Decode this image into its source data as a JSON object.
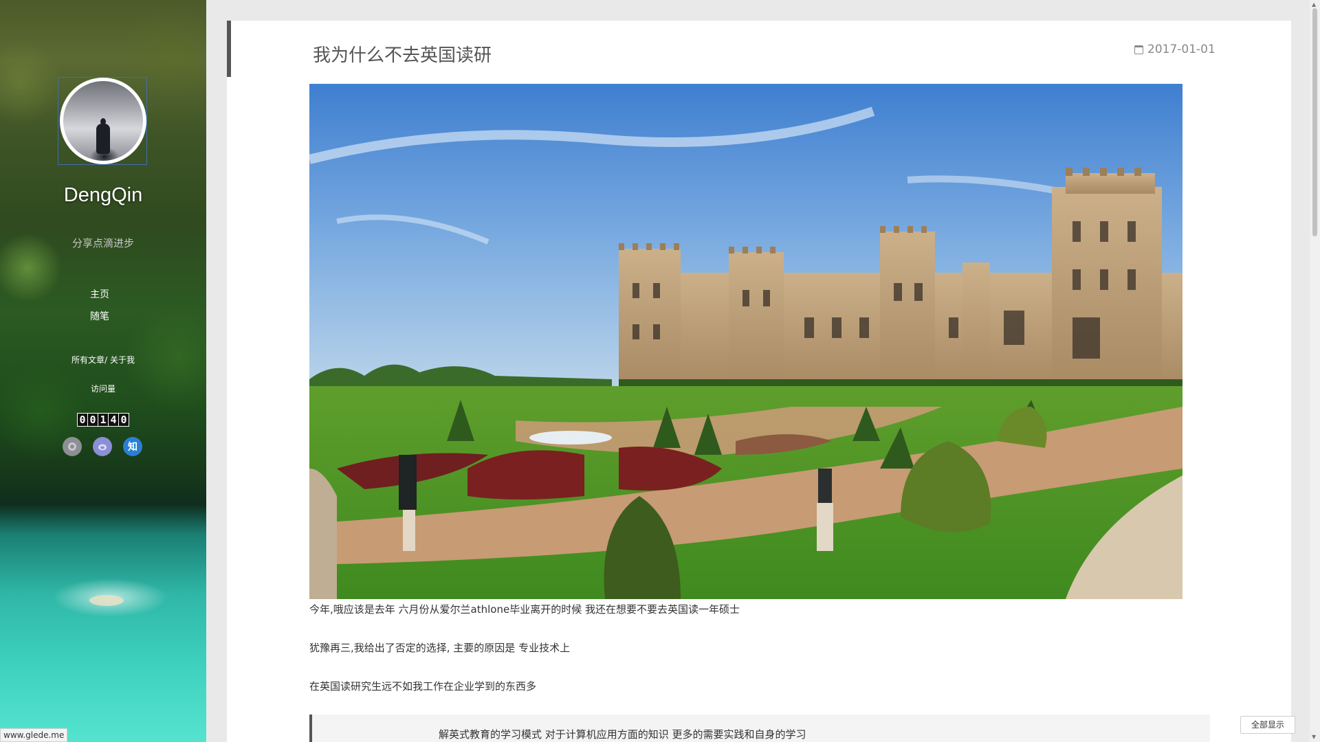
{
  "sidebar": {
    "site_name": "DengQin",
    "tagline": "分享点滴进步",
    "nav": [
      {
        "label": "主页"
      },
      {
        "label": "随笔"
      }
    ],
    "links": {
      "all_posts": "所有文章",
      "separator": "/",
      "about": "关于我"
    },
    "visit_label": "访问量",
    "visit_count_digits": [
      "0",
      "0",
      "1",
      "4",
      "0"
    ],
    "social": [
      {
        "icon": "github-icon"
      },
      {
        "icon": "weibo-icon"
      },
      {
        "icon": "zhihu-icon",
        "glyph": "知"
      }
    ]
  },
  "post": {
    "title": "我为什么不去英国读研",
    "date": "2017-01-01",
    "image_subject": "castle-garden-photo",
    "paragraphs": [
      "今年,哦应该是去年 六月份从爱尔兰athlone毕业离开的时候 我还在想要不要去英国读一年硕士",
      "犹豫再三,我给出了否定的选择, 主要的原因是 专业技术上",
      "在英国读研究生远不如我工作在企业学到的东西多"
    ],
    "quote_partial": "解英式教育的学习模式 对于计算机应用方面的知识 更多的需要实践和自身的学习"
  },
  "status_bar": {
    "url": "www.glede.me"
  },
  "show_all_button": "全部显示"
}
